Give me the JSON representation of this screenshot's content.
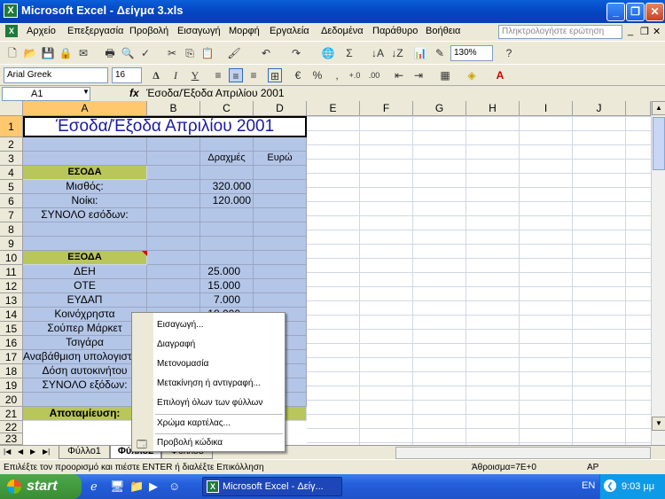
{
  "window": {
    "title": "Microsoft Excel - Δείγμα 3.xls"
  },
  "menu": [
    "Αρχείο",
    "Επεξεργασία",
    "Προβολή",
    "Εισαγωγή",
    "Μορφή",
    "Εργαλεία",
    "Δεδομένα",
    "Παράθυρο",
    "Βοήθεια"
  ],
  "ask_placeholder": "Πληκτρολογήστε ερώτηση",
  "toolbar": {
    "zoom": "130%",
    "font_name": "Arial Greek",
    "font_size": "16"
  },
  "formula_bar": {
    "name_box": "A1",
    "fx": "fx",
    "formula": "Έσοδα/Έξοδα Απριλίου 2001"
  },
  "columns": [
    "A",
    "B",
    "C",
    "D",
    "E",
    "F",
    "G",
    "H",
    "I",
    "J"
  ],
  "rows": [
    "1",
    "2",
    "3",
    "4",
    "5",
    "6",
    "7",
    "8",
    "9",
    "10",
    "11",
    "12",
    "13",
    "14",
    "15",
    "16",
    "17",
    "18",
    "19",
    "20",
    "21",
    "22",
    "23"
  ],
  "cells": {
    "A1": "Έσοδα/Έξοδα Απριλίου 2001",
    "C3": "Δραχμές",
    "D3": "Ευρώ",
    "A4": "ΕΣΟΔΑ",
    "A5": "Μισθός:",
    "C5": "320.000",
    "A6": "Νοίκι:",
    "C6": "120.000",
    "A7": "ΣΥΝΟΛΟ εσόδων:",
    "A10": "ΕΞΟΔΑ",
    "A11": "ΔΕΗ",
    "C11": "25.000",
    "A12": "ΟΤΕ",
    "C12": "15.000",
    "A13": "ΕΥΔΑΠ",
    "C13": "7.000",
    "A14": "Κοινόχρηστα",
    "C14": "18.000",
    "A15": "Σούπερ Μάρκετ",
    "A16": "Τσιγάρα",
    "A17": "Αναβάθμιση υπολογιστή",
    "A18": "Δόση αυτοκινήτου",
    "A19": "ΣΥΝΟΛΟ εξόδων:",
    "A21": "Αποταμίευση:"
  },
  "context_menu": [
    "Εισαγωγή...",
    "Διαγραφή",
    "Μετονομασία",
    "Μετακίνηση ή αντιγραφή...",
    "Επιλογή όλων των φύλλων",
    "Χρώμα καρτέλας...",
    "Προβολή κώδικα"
  ],
  "sheet_tabs": [
    "Φύλλο1",
    "Φύλλο2",
    "Φύλλο3"
  ],
  "status": {
    "message": "Επιλέξτε τον προορισμό και πιέστε ENTER ή διαλέξτε Επικόλληση",
    "sum": "Άθροισμα=7E+0",
    "mode": "ΑΡ"
  },
  "taskbar": {
    "start": "start",
    "app": "Microsoft Excel - Δείγ...",
    "lang": "EN",
    "clock": "9:03 μμ"
  }
}
